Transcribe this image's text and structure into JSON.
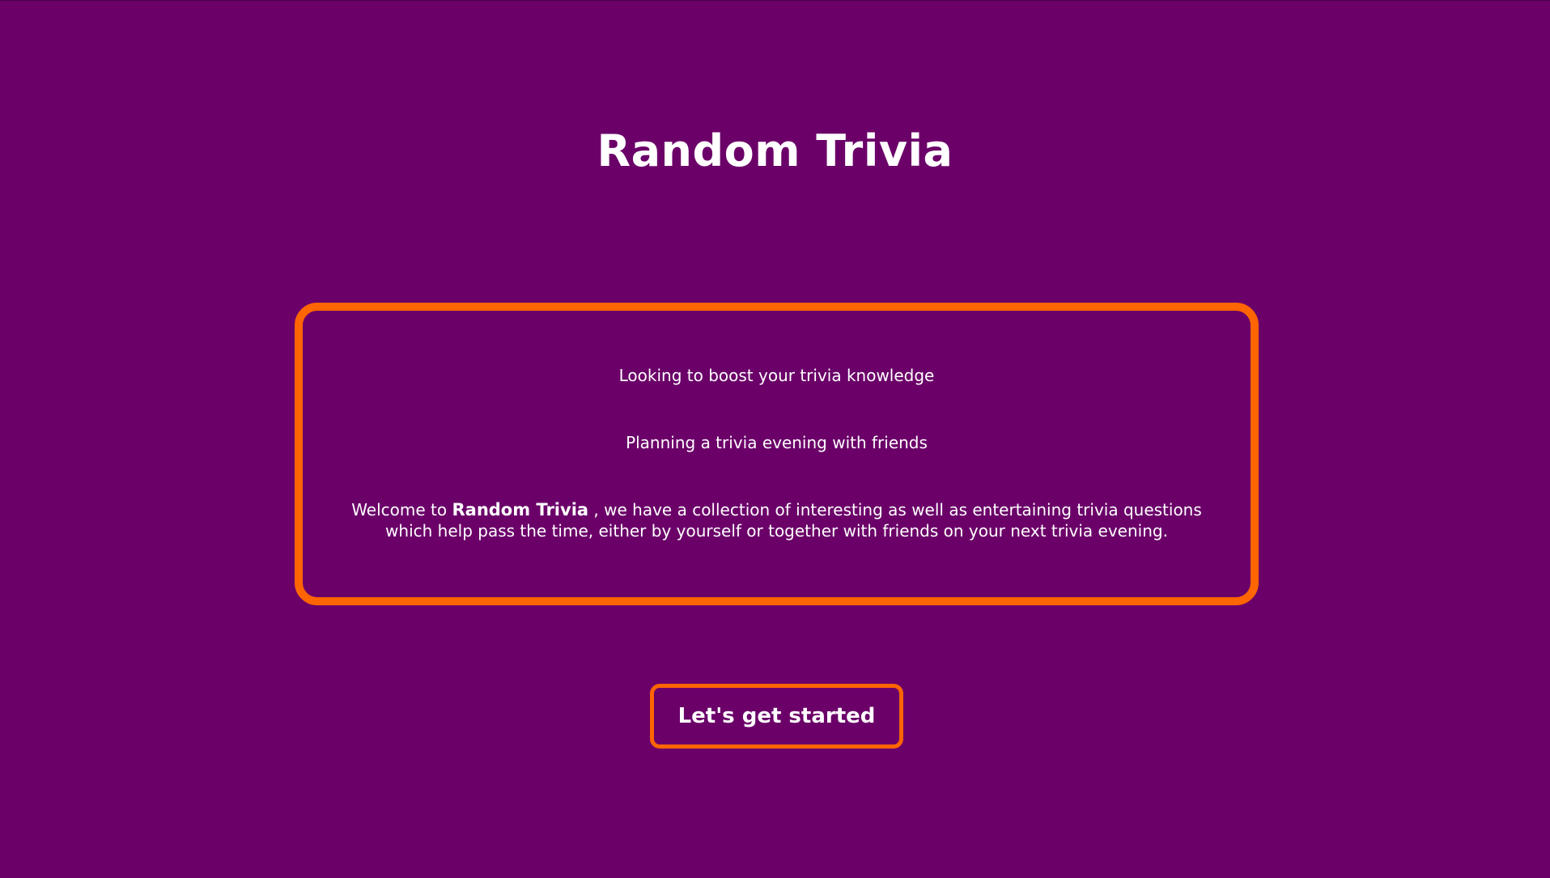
{
  "page": {
    "title": "Random Trivia"
  },
  "intro": {
    "line_1": "Looking to boost your trivia knowledge",
    "line_2": "Planning a trivia evening with friends",
    "welcome_prefix": "Welcome to",
    "welcome_brand": "Random Trivia",
    "welcome_suffix": ", we have a collection of interesting as well as entertaining trivia questions which help pass the time, either by yourself or together with friends on your next trivia evening."
  },
  "actions": {
    "start_label": "Let's get started"
  },
  "colors": {
    "background": "#6b0069",
    "accent": "#ff6500",
    "text": "#ffffff"
  }
}
